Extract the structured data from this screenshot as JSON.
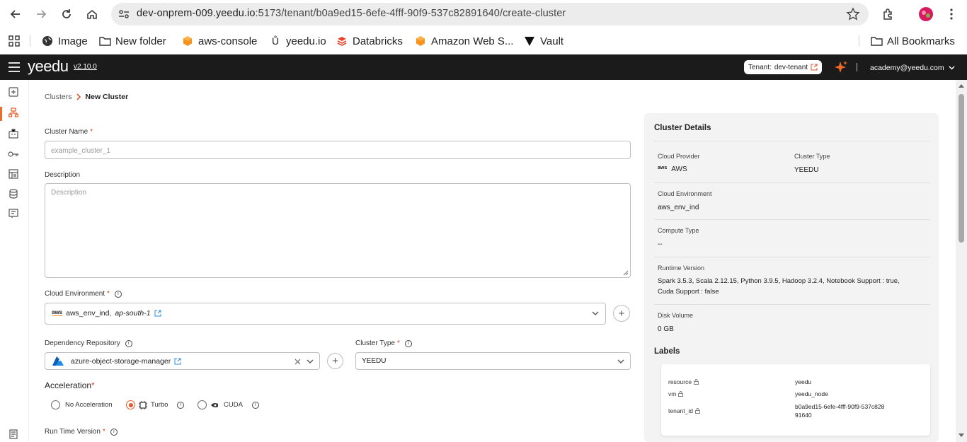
{
  "browser": {
    "url_host": "dev-onprem-009.yeedu.io",
    "url_path": ":5173/tenant/b0a9ed15-6efe-4fff-90f9-537c82891640/create-cluster",
    "bookmarks": [
      "Image",
      "New folder",
      "aws-console",
      "yeedu.io",
      "Databricks",
      "Amazon Web S...",
      "Vault"
    ],
    "all_bookmarks": "All Bookmarks"
  },
  "header": {
    "logo": "yeedu",
    "version": "v2.10.0",
    "tenant_label": "Tenant:",
    "tenant_value": "dev-tenant",
    "user_email": "academy@yeedu.com"
  },
  "breadcrumb": {
    "parent": "Clusters",
    "current": "New Cluster"
  },
  "form": {
    "cluster_name_label": "Cluster Name",
    "cluster_name_placeholder": "example_cluster_1",
    "description_label": "Description",
    "description_placeholder": "Description",
    "cloud_env_label": "Cloud Environment",
    "cloud_env_value": "aws_env_ind,",
    "cloud_env_region": "ap-south-1",
    "dep_repo_label": "Dependency Repository",
    "dep_repo_value": "azure-object-storage-manager",
    "cluster_type_label": "Cluster Type",
    "cluster_type_value": "YEEDU",
    "acceleration_label": "Acceleration",
    "acceleration_options": [
      "No Acceleration",
      "Turbo",
      "CUDA"
    ],
    "acceleration_selected": "Turbo",
    "runtime_label": "Run Time Version"
  },
  "details": {
    "title": "Cluster Details",
    "cloud_provider_label": "Cloud Provider",
    "cloud_provider_value": "AWS",
    "cluster_type_label": "Cluster Type",
    "cluster_type_value": "YEEDU",
    "cloud_env_label": "Cloud Environment",
    "cloud_env_value": "aws_env_ind",
    "compute_type_label": "Compute Type",
    "compute_type_value": "--",
    "runtime_label": "Runtime Version",
    "runtime_value_line1": "Spark 3.5.3, Scala 2.12.15, Python 3.9.5, Hadoop 3.2.4, Notebook Support : true,",
    "runtime_value_line2": "Cuda Support : false",
    "disk_label": "Disk Volume",
    "disk_value": "0 GB",
    "labels_title": "Labels",
    "labels": [
      {
        "key": "resource",
        "value": "yeedu"
      },
      {
        "key": "vm",
        "value": "yeedu_node"
      },
      {
        "key": "tenant_id",
        "value": "b0a9ed15-6efe-4fff-90f9-537c82891640"
      }
    ]
  },
  "colors": {
    "accent": "#e5562b",
    "header_bg": "#1b1b1b",
    "panel_bg": "#f3f3f3"
  }
}
